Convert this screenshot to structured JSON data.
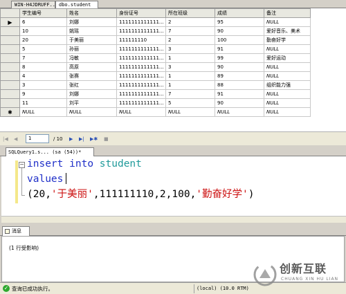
{
  "top_tabs": {
    "server_tab": "WIN-H4JDRUFF...",
    "table_tab": "dbo.student"
  },
  "grid": {
    "columns": [
      "学生编号",
      "姓名",
      "身份证号",
      "所在班级",
      "成绩",
      "备注"
    ],
    "rows": [
      {
        "marker": "▶",
        "cells": [
          "6",
          "刘娜",
          "1111111111111...",
          "2",
          "95",
          "NULL"
        ]
      },
      {
        "marker": "",
        "cells": [
          "10",
          "姚瑶",
          "1111111111111...",
          "7",
          "90",
          "爱好音乐、美术"
        ]
      },
      {
        "marker": "",
        "cells": [
          "20",
          "于美丽",
          "111111110",
          "2",
          "100",
          "勤奋好学"
        ]
      },
      {
        "marker": "",
        "cells": [
          "5",
          "孙丽",
          "1111111111111...",
          "3",
          "91",
          "NULL"
        ]
      },
      {
        "marker": "",
        "cells": [
          "7",
          "冯敏",
          "1111111111111...",
          "1",
          "99",
          "爱好运动"
        ]
      },
      {
        "marker": "",
        "cells": [
          "8",
          "高原",
          "1111111111111...",
          "3",
          "90",
          "NULL"
        ]
      },
      {
        "marker": "",
        "cells": [
          "4",
          "张赛",
          "1111111111111...",
          "1",
          "89",
          "NULL"
        ]
      },
      {
        "marker": "",
        "cells": [
          "3",
          "张红",
          "1111111111111...",
          "1",
          "88",
          "组织能力强"
        ]
      },
      {
        "marker": "",
        "cells": [
          "9",
          "刘娜",
          "1111111111111...",
          "7",
          "91",
          "NULL"
        ]
      },
      {
        "marker": "",
        "cells": [
          "11",
          "刘平",
          "1111111111111...",
          "5",
          "90",
          "NULL"
        ]
      },
      {
        "marker": "✱",
        "cells": [
          "NULL",
          "NULL",
          "NULL",
          "NULL",
          "NULL",
          "NULL"
        ]
      }
    ]
  },
  "pager": {
    "current_page": "1",
    "total": "/ 10"
  },
  "query_tab": {
    "label": "SQLQuery1.s... (sa (54))*"
  },
  "editor": {
    "line1": {
      "kw1": "insert",
      "kw2": "into",
      "table": "student"
    },
    "line2": {
      "kw": "values"
    },
    "line3": {
      "open": "(20,",
      "name": "'于美丽'",
      "mid": ",111111110,2,100,",
      "note": "'勤奋好学'",
      "close": ")"
    }
  },
  "messages": {
    "tab_label": "消息",
    "text": "(1 行受影响)"
  },
  "status": {
    "text": "查询已成功执行。",
    "server": "(local) (10.0 RTM)"
  },
  "watermark": {
    "cn": "创新互联",
    "en": "CHUANG XIN HU LIAN"
  },
  "colors": {
    "keyword": "#1f2fc8",
    "string": "#cc1010",
    "identifier": "#1f9a9a",
    "success": "#2ea82e"
  }
}
